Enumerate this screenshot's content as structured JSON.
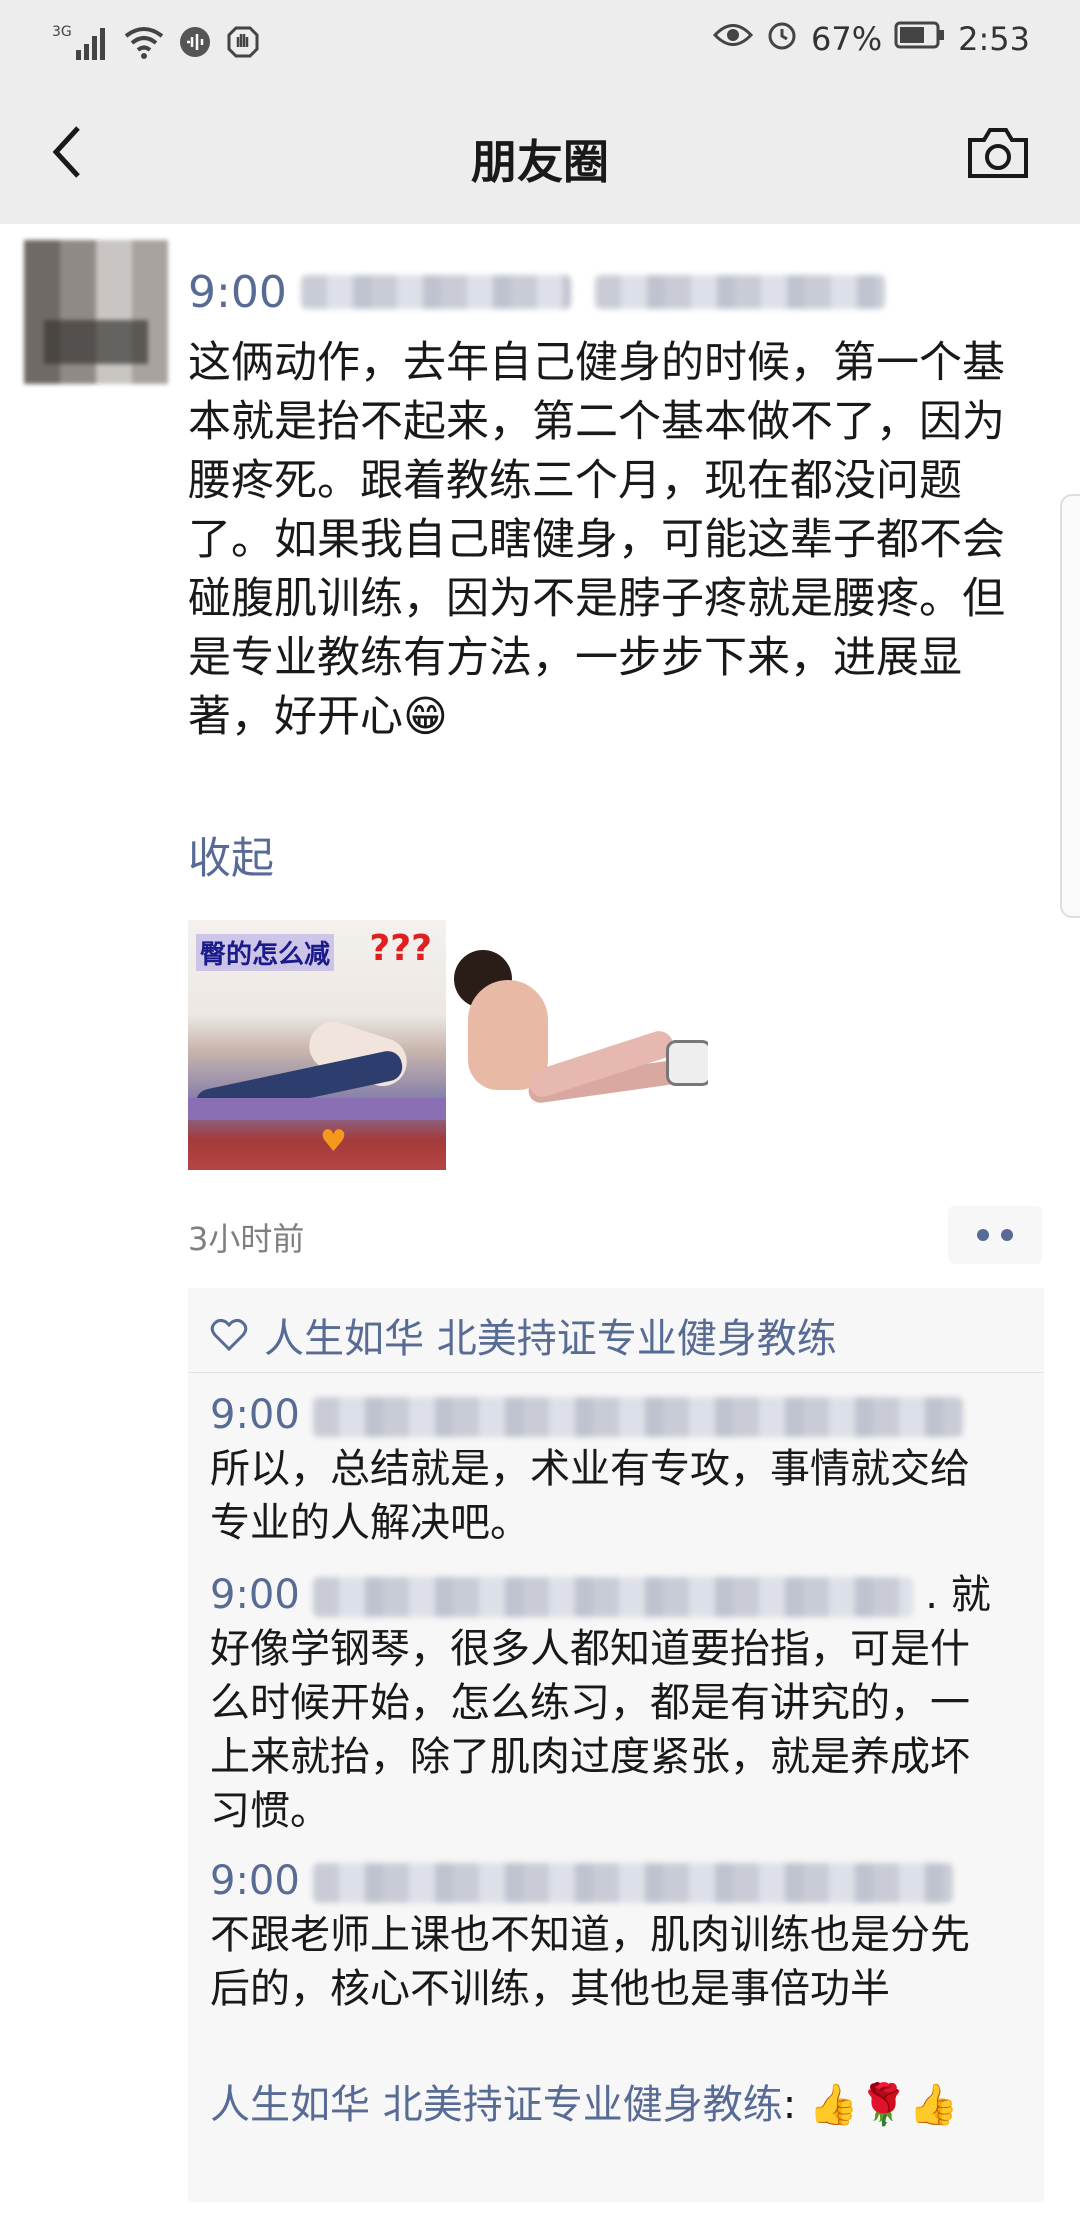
{
  "status_bar": {
    "network": "3G",
    "battery": "67%",
    "time": "2:53"
  },
  "header": {
    "title": "朋友圈"
  },
  "post": {
    "time": "9:00",
    "text": "这俩动作，去年自己健身的时候，第一个基本就是抬不起来，第二个基本做不了，因为腰疼死。跟着教练三个月，现在都没问题了。如果我自己瞎健身，可能这辈子都不会碰腹肌训练，因为不是脖子疼就是腰疼。但是专业教练有方法，一步步下来，进展显著，好开心😁",
    "collapse_label": "收起",
    "image1_caption": "臀的怎么减",
    "image1_mark": "???",
    "time_ago": "3小时前"
  },
  "likes": {
    "names": "人生如华 北美持证专业健身教练"
  },
  "comments": [
    {
      "time": "9:00",
      "text": "所以，总结就是，术业有专攻，事情就交给专业的人解决吧。"
    },
    {
      "time": "9:00",
      "text": ". 就好像学钢琴，很多人都知道要抬指，可是什么时候开始，怎么练习，都是有讲究的，一上来就抬，除了肌肉过度紧张，就是养成坏习惯。"
    },
    {
      "time": "9:00",
      "text": "不跟老师上课也不知道，肌肉训练也是分先后的，核心不训练，其他也是事倍功半"
    },
    {
      "name": "人生如华 北美持证专业健身教练",
      "text": ": 👍🌹👍"
    }
  ],
  "colors": {
    "link": "#576b95",
    "bar_bg": "#ededed",
    "comment_bg": "#f7f7f7"
  }
}
